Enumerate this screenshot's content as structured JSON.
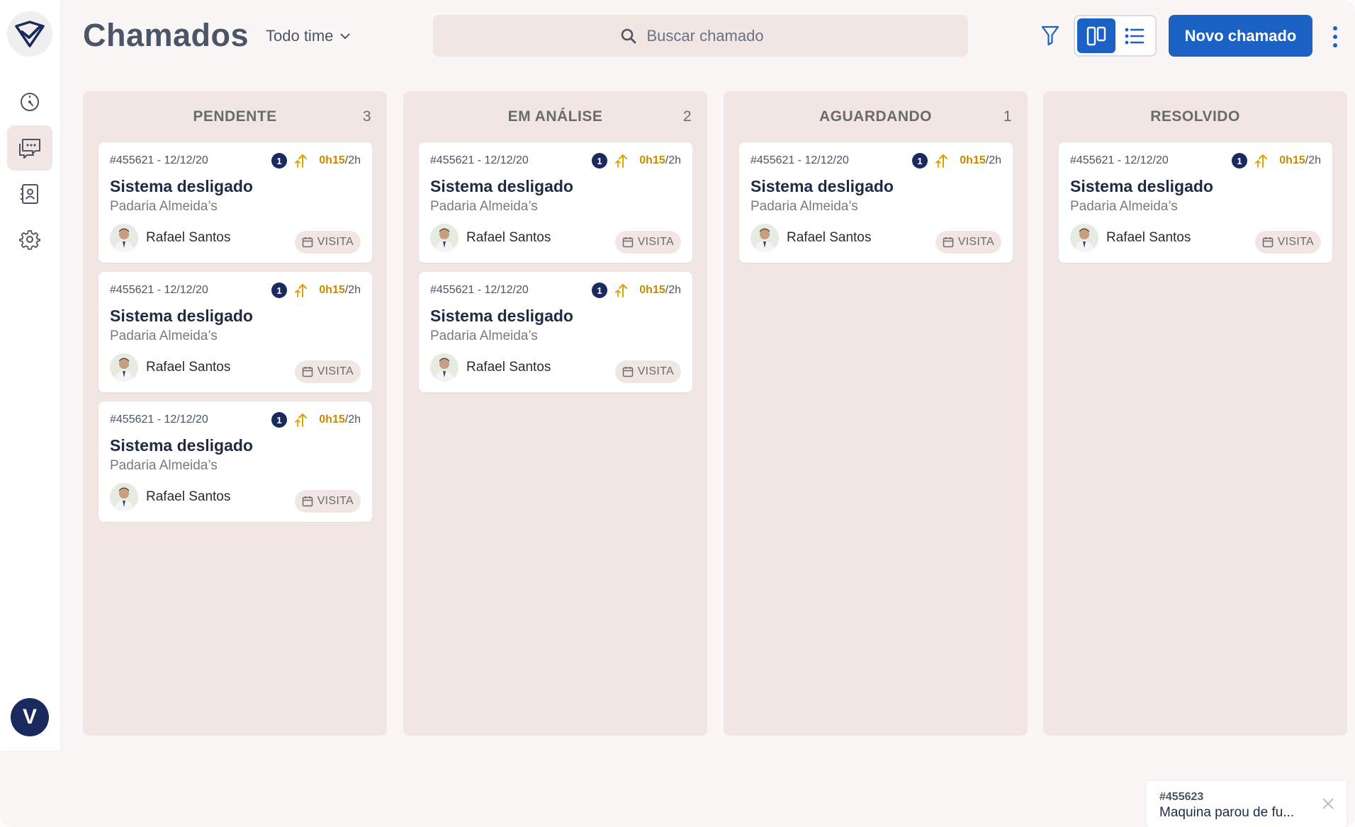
{
  "header": {
    "title": "Chamados",
    "team_filter": "Todo time",
    "search_placeholder": "Buscar chamado",
    "new_button": "Novo chamado"
  },
  "sidebar": {
    "items": [
      {
        "name": "dashboard",
        "icon": "gauge-icon"
      },
      {
        "name": "tickets",
        "icon": "chat-icon",
        "active": true
      },
      {
        "name": "contacts",
        "icon": "contact-book-icon"
      },
      {
        "name": "settings",
        "icon": "gear-icon"
      }
    ],
    "user_initial": "V"
  },
  "view": {
    "mode": "kanban"
  },
  "colors": {
    "primary": "#1c62c4",
    "navy": "#1a2a5e",
    "column_bg": "#f1e6e4",
    "time_accent": "#c88a00"
  },
  "columns": [
    {
      "title": "PENDENTE",
      "count": "3",
      "cards": [
        {
          "id_date": "#455621 - 12/12/20",
          "priority": "1",
          "time_spent": "0h15",
          "time_limit": "/2h",
          "title": "Sistema desligado",
          "client": "Padaria Almeida’s",
          "assignee": "Rafael Santos",
          "tag": "VISITA"
        },
        {
          "id_date": "#455621 - 12/12/20",
          "priority": "1",
          "time_spent": "0h15",
          "time_limit": "/2h",
          "title": "Sistema desligado",
          "client": "Padaria Almeida’s",
          "assignee": "Rafael Santos",
          "tag": "VISITA"
        },
        {
          "id_date": "#455621 - 12/12/20",
          "priority": "1",
          "time_spent": "0h15",
          "time_limit": "/2h",
          "title": "Sistema desligado",
          "client": "Padaria Almeida’s",
          "assignee": "Rafael Santos",
          "tag": "VISITA"
        }
      ]
    },
    {
      "title": "EM ANÁLISE",
      "count": "2",
      "cards": [
        {
          "id_date": "#455621 - 12/12/20",
          "priority": "1",
          "time_spent": "0h15",
          "time_limit": "/2h",
          "title": "Sistema desligado",
          "client": "Padaria Almeida’s",
          "assignee": "Rafael Santos",
          "tag": "VISITA"
        },
        {
          "id_date": "#455621 - 12/12/20",
          "priority": "1",
          "time_spent": "0h15",
          "time_limit": "/2h",
          "title": "Sistema desligado",
          "client": "Padaria Almeida’s",
          "assignee": "Rafael Santos",
          "tag": "VISITA"
        }
      ]
    },
    {
      "title": "AGUARDANDO",
      "count": "1",
      "cards": [
        {
          "id_date": "#455621 - 12/12/20",
          "priority": "1",
          "time_spent": "0h15",
          "time_limit": "/2h",
          "title": "Sistema desligado",
          "client": "Padaria Almeida’s",
          "assignee": "Rafael Santos",
          "tag": "VISITA"
        }
      ]
    },
    {
      "title": "RESOLVIDO",
      "count": "",
      "cards": [
        {
          "id_date": "#455621 - 12/12/20",
          "priority": "1",
          "time_spent": "0h15",
          "time_limit": "/2h",
          "title": "Sistema desligado",
          "client": "Padaria Almeida’s",
          "assignee": "Rafael Santos",
          "tag": "VISITA"
        }
      ]
    }
  ],
  "toast": {
    "id": "#455623",
    "message": "Maquina parou de fu..."
  }
}
